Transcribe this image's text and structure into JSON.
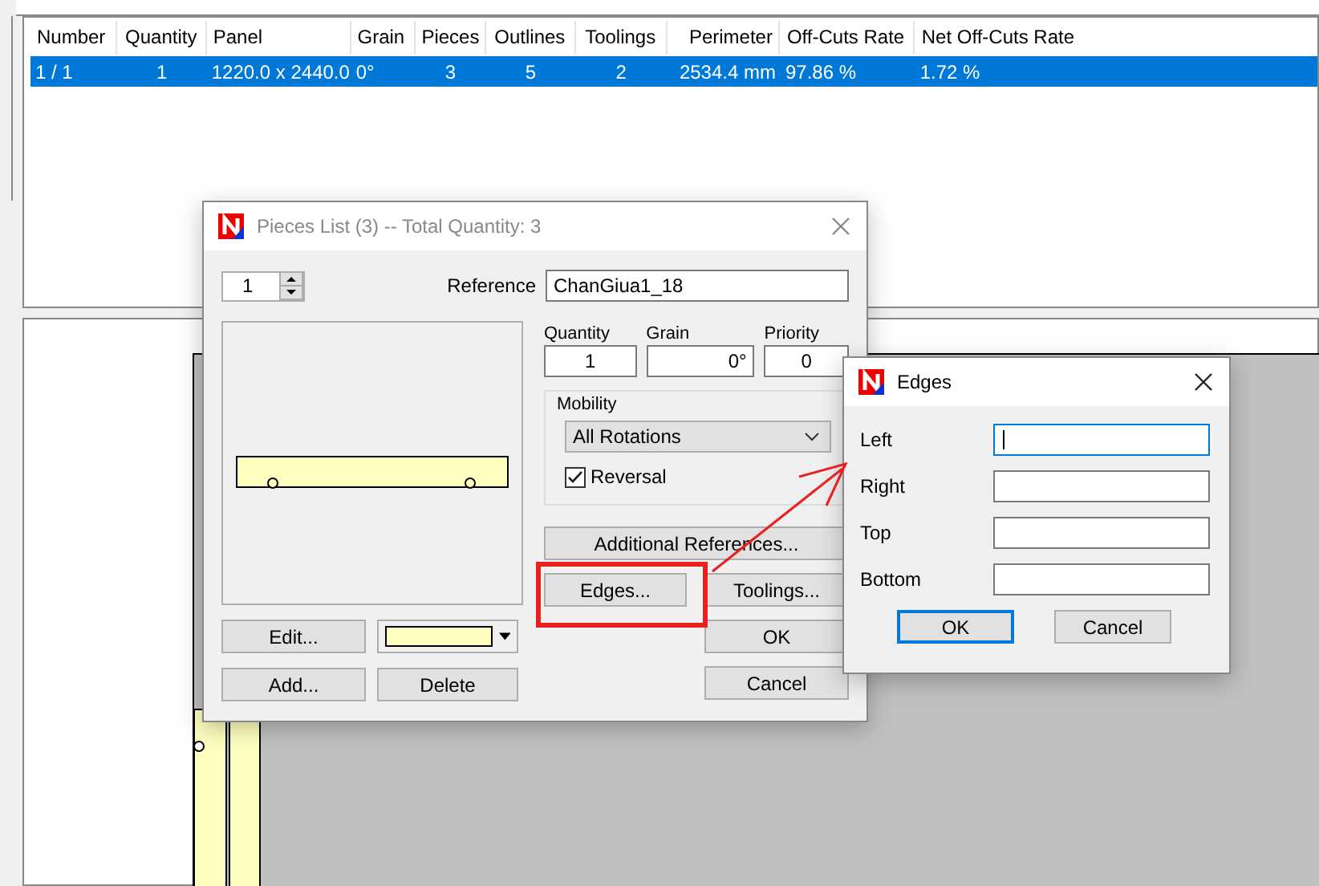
{
  "table": {
    "columns": [
      "Number",
      "Quantity",
      "Panel",
      "Grain",
      "Pieces",
      "Outlines",
      "Toolings",
      "Perimeter",
      "Off-Cuts Rate",
      "Net Off-Cuts Rate"
    ],
    "rows": [
      {
        "cells": [
          "1 / 1",
          "1",
          "1220.0 x 2440.0",
          "0°",
          "3",
          "5",
          "2",
          "2534.4 mm",
          "97.86 %",
          "1.72 %"
        ],
        "selected": true
      }
    ]
  },
  "pieces_dialog": {
    "title": "Pieces List (3) -- Total Quantity: 3",
    "index": "1",
    "reference_label": "Reference",
    "reference": "ChanGiua1_18",
    "fields": [
      {
        "label": "Quantity",
        "value": "1"
      },
      {
        "label": "Grain",
        "value": "0°"
      },
      {
        "label": "Priority",
        "value": "0"
      }
    ],
    "mobility": {
      "label": "Mobility",
      "value": "All Rotations",
      "reversal_label": "Reversal",
      "reversal_checked": true
    },
    "additional_references": "Additional References...",
    "edges_button": "Edges...",
    "toolings_button": "Toolings...",
    "ok": "OK",
    "cancel": "Cancel",
    "edit": "Edit...",
    "add": "Add...",
    "delete": "Delete",
    "color": "#ffffc0"
  },
  "edges_dialog": {
    "title": "Edges",
    "fields": [
      {
        "label": "Left",
        "focused": true
      },
      {
        "label": "Right",
        "focused": false
      },
      {
        "label": "Top",
        "focused": false
      },
      {
        "label": "Bottom",
        "focused": false
      }
    ],
    "buttons": [
      {
        "label": "OK",
        "default": true
      },
      {
        "label": "Cancel",
        "default": false
      }
    ]
  }
}
